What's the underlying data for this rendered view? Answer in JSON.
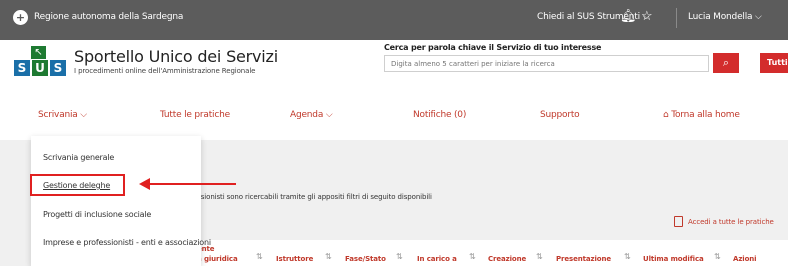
{
  "topbar": {
    "region": "Regione autonoma della Sardegna",
    "help": "Chiedi al SUS",
    "tools": "Strumenti",
    "user": "Lucia Mondella"
  },
  "brand": {
    "logo_letters": [
      "S",
      "U",
      "S"
    ],
    "title": "Sportello Unico dei Servizi",
    "subtitle": "I procedimenti online dell'Amministrazione Regionale"
  },
  "search": {
    "label": "Cerca per parola chiave il Servizio di tuo interesse",
    "placeholder": "Digita almeno 5 caratteri per iniziare la ricerca",
    "filter": "Tutti"
  },
  "nav": {
    "scrivania": "Scrivania",
    "pratiche": "Tutte le pratiche",
    "agenda": "Agenda",
    "notifiche": "Notifiche (0)",
    "supporto": "Supporto",
    "home": "Torna alla home"
  },
  "dropdown": {
    "items": [
      "Scrivania generale",
      "Gestione deleghe",
      "Progetti di inclusione sociale",
      "Imprese e professionisti - enti e associazioni"
    ]
  },
  "content": {
    "text": "essionisti sono ricercabili tramite gli appositi filtri di seguito disponibili",
    "access_link": "Accedi a tutte le pratiche"
  },
  "table": {
    "headers": {
      "ragione": "ente\na giuridica",
      "istruttore": "Istruttore",
      "fase": "Fase/Stato",
      "carico": "In carico a",
      "creazione": "Creazione",
      "presentazione": "Presentazione",
      "modifica": "Ultima modifica",
      "azioni": "Azioni"
    }
  },
  "colors": {
    "accent": "#c0392b",
    "topbar": "#5c5c5c",
    "highlight": "#e02020",
    "logo_blue": "#1a6fa8",
    "logo_green": "#1e7a32"
  }
}
